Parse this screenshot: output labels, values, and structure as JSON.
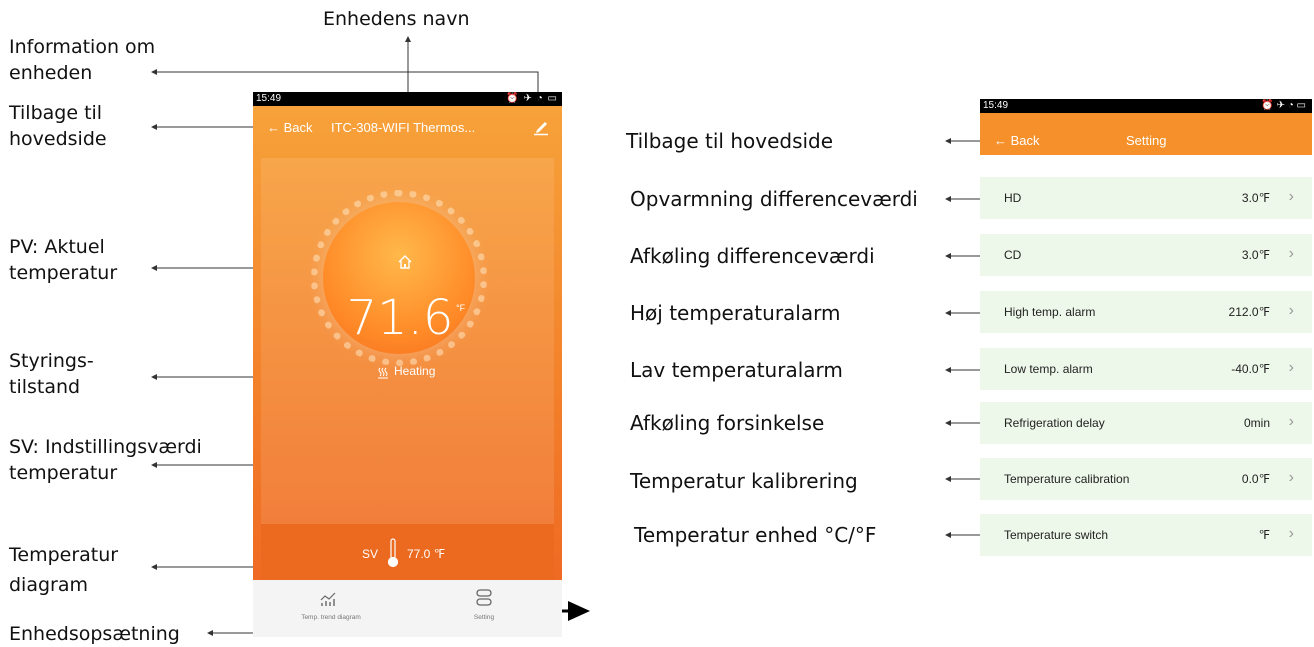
{
  "callouts_left": {
    "device_name": "Enhedens navn",
    "device_info": "Information om\nenheden",
    "back_home": "Tilbage til\nhovedside",
    "pv": "PV: Aktuel\ntemperatur",
    "control_state": "Styrings-\ntilstand",
    "sv": "SV: Indstillingsværdi\ntemperatur",
    "temp_diagram": "Temperatur\ndiagram",
    "device_setup": "Enhedsopsætning"
  },
  "phone_main": {
    "status_time": "15:49",
    "back_label": "← Back",
    "title": "ITC-308-WIFI Thermos...",
    "pv_value": "71.6",
    "pv_unit": "°F",
    "mode_label": "Heating",
    "sv_label": "SV",
    "sv_value": "77.0 ℉",
    "tab_trend": "Temp. trend diagram",
    "tab_setting": "Setting"
  },
  "callouts_right": [
    "Tilbage til hovedside",
    "Opvarmning differenceværdi",
    "Afkøling differenceværdi",
    "Høj temperaturalarm",
    "Lav temperaturalarm",
    "Afkøling forsinkelse",
    "Temperatur kalibrering",
    "Temperatur enhed °C/°F"
  ],
  "phone_settings": {
    "status_time": "15:49",
    "back_label": "← Back",
    "title": "Setting",
    "rows": [
      {
        "label": "HD",
        "value": "3.0℉"
      },
      {
        "label": "CD",
        "value": "3.0℉"
      },
      {
        "label": "High temp. alarm",
        "value": "212.0℉"
      },
      {
        "label": "Low temp. alarm",
        "value": "-40.0℉"
      },
      {
        "label": "Refrigeration delay",
        "value": "0min"
      },
      {
        "label": "Temperature calibration",
        "value": "0.0℉"
      },
      {
        "label": "Temperature switch",
        "value": "℉"
      }
    ]
  },
  "colors": {
    "accent_orange": "#f5902a",
    "row_green": "#eef8ea"
  }
}
